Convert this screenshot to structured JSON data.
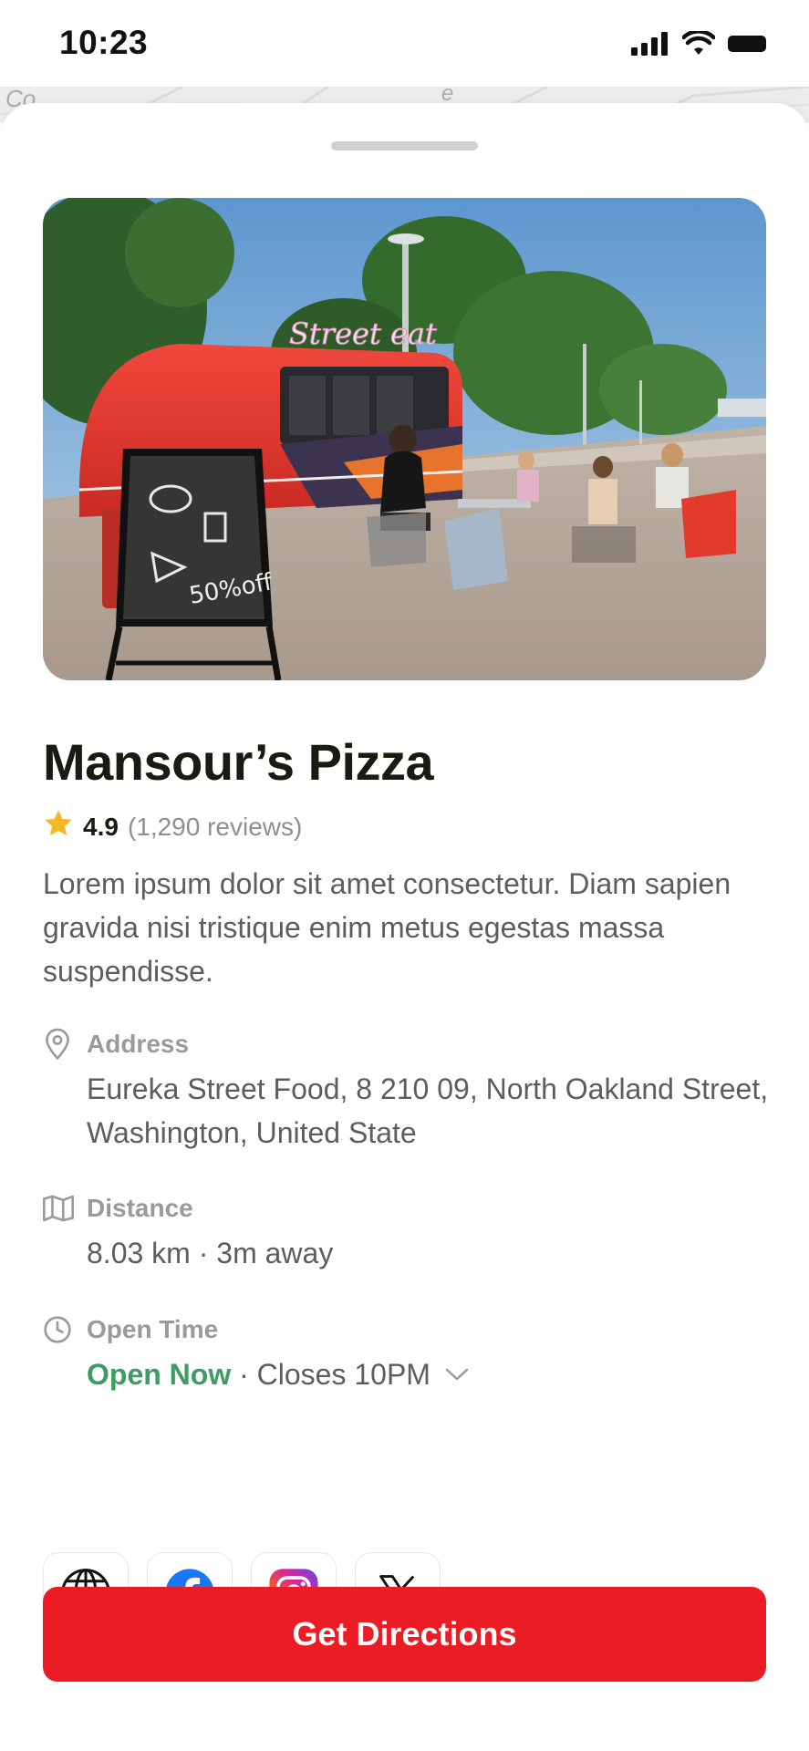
{
  "status_bar": {
    "time": "10:23"
  },
  "map": {
    "label_left": "Co",
    "label_right": "e"
  },
  "restaurant": {
    "name": "Mansour’s Pizza",
    "rating": "4.9",
    "reviews": "(1,290 reviews)",
    "description": "Lorem ipsum dolor sit amet consectetur. Diam sapien gravida nisi tristique enim metus egestas massa suspendisse.",
    "hero_image": {
      "truck_sign": "Street eat",
      "board_text": "50%off"
    }
  },
  "info": {
    "address_label": "Address",
    "address_value": "Eureka Street Food, 8 210 09, North Oakland Street, Washington, United State",
    "distance_label": "Distance",
    "distance_value": "8.03 km · 3m away",
    "open_label": "Open Time",
    "open_status": "Open Now",
    "open_separator": " · ",
    "closes": "Closes 10PM"
  },
  "socials": [
    {
      "name": "website",
      "icon": "globe-icon"
    },
    {
      "name": "facebook",
      "icon": "facebook-icon"
    },
    {
      "name": "instagram",
      "icon": "instagram-icon"
    },
    {
      "name": "x",
      "icon": "x-icon"
    }
  ],
  "cta": {
    "label": "Get Directions"
  },
  "colors": {
    "accent": "#eb1c24",
    "open": "#3e9b61",
    "star": "#f5b824"
  }
}
